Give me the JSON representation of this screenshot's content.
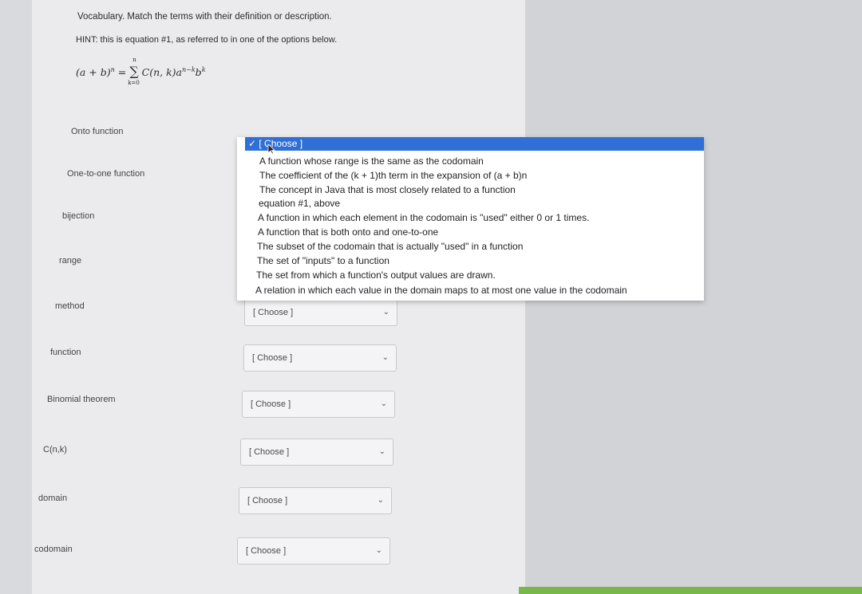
{
  "instructions": "Vocabulary. Match the terms with their definition or description.",
  "hint": "HINT: this is equation #1, as referred to in one of the options below.",
  "equation": {
    "lhs": "(a + b)",
    "lhs_exp": "n",
    "eq": " = ",
    "sum_symbol": "∑",
    "sum_top": "n",
    "sum_bottom": "k=0",
    "term": "C(n, k)a",
    "term_exp1": "n−k",
    "term_b": "b",
    "term_exp2": "k"
  },
  "terms": [
    "Onto function",
    "One-to-one function",
    "bijection",
    "range",
    "method",
    "function",
    "Binomial theorem",
    "C(n,k)",
    "domain",
    "codomain"
  ],
  "select_placeholder": "[ Choose ]",
  "chevron_glyph": "⌄",
  "dropdown": {
    "selected": "✓ [ Choose ]",
    "options": [
      "A function whose range is the same as the codomain",
      "The coefficient of the (k + 1)th term in the expansion of (a + b)n",
      "The concept in Java that is most closely related to a function",
      "equation #1, above",
      "A function in which each element in the codomain is \"used\" either 0 or 1 times.",
      "A function that is both onto and one-to-one",
      "The subset of the codomain that is actually \"used\" in a function",
      "The set of \"inputs\" to a function",
      "The set from which a function's output values are drawn.",
      "A relation in which each value in the domain maps to at most one value in the codomain"
    ]
  }
}
